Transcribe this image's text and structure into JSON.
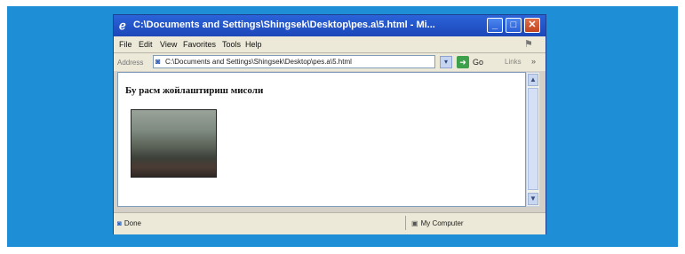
{
  "window": {
    "title": "C:\\Documents and Settings\\Shingsek\\Desktop\\pes.a\\5.html - Mi...",
    "minimize_label": "_",
    "maximize_label": "□",
    "close_label": "✕"
  },
  "menu": {
    "items": [
      "File",
      "Edit",
      "View",
      "Favorites",
      "Tools",
      "Help"
    ]
  },
  "address": {
    "label": "Address",
    "value": "C:\\Documents and Settings\\Shingsek\\Desktop\\pes.a\\5.html",
    "go_label": "Go",
    "links_label": "Links"
  },
  "page": {
    "heading": "Бу расм жойлаштириш мисоли"
  },
  "status": {
    "left": "Done",
    "right": "My Computer"
  },
  "icons": {
    "window": "ie-icon",
    "address": "page-icon",
    "go": "go-arrow-icon",
    "status_left": "page-done-icon",
    "status_right": "my-computer-icon",
    "windows_flag": "windows-flag-icon"
  },
  "colors": {
    "desktop": "#1e8fd6",
    "titlebar": "#2b63d9",
    "close": "#c2431d",
    "chrome": "#ece9d8"
  }
}
